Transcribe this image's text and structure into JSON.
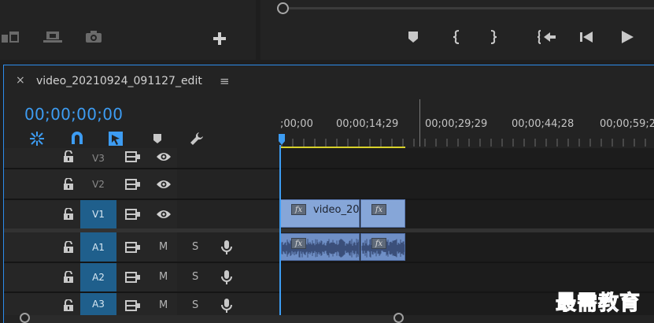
{
  "sequence": {
    "tab_title": "video_20210924_091127_edit",
    "close_glyph": "×",
    "menu_glyph": "≡",
    "timecode": "00;00;00;00"
  },
  "ruler": {
    "labels": [
      ";00;00",
      "00;00;14;29",
      "00;00;29;29",
      "00;00;44;28",
      "00;00;59;2"
    ]
  },
  "tracks": {
    "video": [
      {
        "name": "V3",
        "targeted": false
      },
      {
        "name": "V2",
        "targeted": false
      },
      {
        "name": "V1",
        "targeted": true
      }
    ],
    "audio": [
      {
        "name": "A1",
        "mute": "M",
        "solo": "S",
        "targeted": true
      },
      {
        "name": "A2",
        "mute": "M",
        "solo": "S",
        "targeted": true
      },
      {
        "name": "A3",
        "mute": "M",
        "solo": "S",
        "targeted": true
      }
    ]
  },
  "clips": {
    "video_label": "video_20",
    "fx_badge": "fx"
  },
  "watermark": "最需教育",
  "colors": {
    "accent": "#3d9cf2",
    "track_target": "#1f5f8c",
    "clip_video": "#86a6d8",
    "clip_audio": "#6f8fc6",
    "work_area": "#d8d12a"
  }
}
